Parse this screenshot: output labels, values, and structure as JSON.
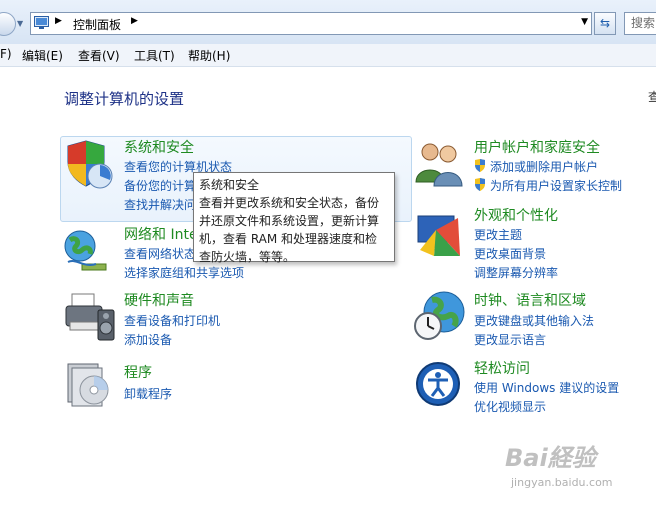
{
  "address_bar": {
    "breadcrumb": "控制面板",
    "search_placeholder": "搜索"
  },
  "menu": [
    {
      "label": "F)"
    },
    {
      "label": "编辑(E)"
    },
    {
      "label": "查看(V)"
    },
    {
      "label": "工具(T)"
    },
    {
      "label": "帮助(H)"
    }
  ],
  "page": {
    "heading": "调整计算机的设置",
    "right_edge_text": "查"
  },
  "categories_left": [
    {
      "title": "系统和安全",
      "links": [
        "查看您的计算机状态",
        "备份您的计算机",
        "查找并解决问题"
      ],
      "icon": "shield-computer-icon"
    },
    {
      "title": "网络和 Internet",
      "links": [
        "查看网络状态和任务",
        "选择家庭组和共享选项"
      ],
      "icon": "network-globe-icon"
    },
    {
      "title": "硬件和声音",
      "links": [
        "查看设备和打印机",
        "添加设备"
      ],
      "icon": "printer-speaker-icon"
    },
    {
      "title": "程序",
      "links": [
        "卸载程序"
      ],
      "icon": "programs-disc-icon"
    }
  ],
  "categories_right": [
    {
      "title": "用户帐户和家庭安全",
      "links": [
        "添加或删除用户帐户",
        "为所有用户设置家长控制"
      ],
      "icon": "users-icon"
    },
    {
      "title": "外观和个性化",
      "links": [
        "更改主题",
        "更改桌面背景",
        "调整屏幕分辨率"
      ],
      "icon": "appearance-palette-icon"
    },
    {
      "title": "时钟、语言和区域",
      "links": [
        "更改键盘或其他输入法",
        "更改显示语言"
      ],
      "icon": "clock-globe-icon"
    },
    {
      "title": "轻松访问",
      "links": [
        "使用 Windows 建议的设置",
        "优化视频显示"
      ],
      "icon": "ease-of-access-icon"
    }
  ],
  "tooltip": {
    "title": "系统和安全",
    "body": "查看并更改系统和安全状态，备份并还原文件和系统设置，更新计算机，查看 RAM 和处理器速度和检查防火墙，等等。"
  },
  "watermark": {
    "main": "Bai経验",
    "sub": "jingyan.baidu.com"
  },
  "colors": {
    "category_title": "#1e8a21",
    "link": "#1a59b0",
    "heading": "#1e3287"
  }
}
